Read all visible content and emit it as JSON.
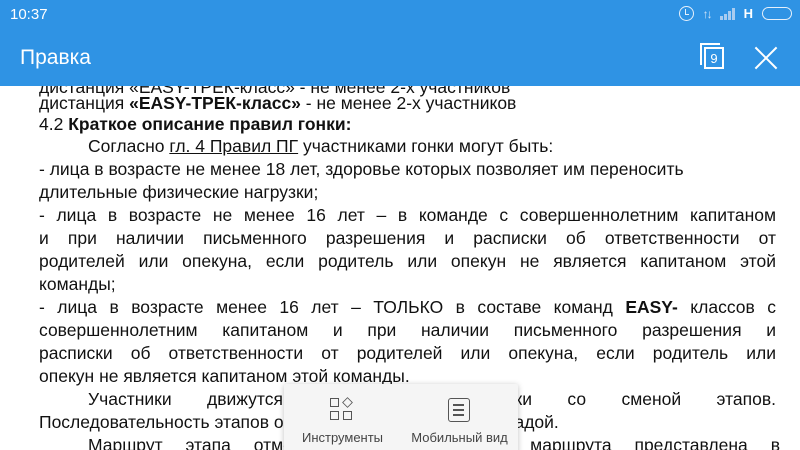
{
  "status_bar": {
    "time": "10:37",
    "network": "H"
  },
  "app_bar": {
    "title": "Правка",
    "pages_count": "9"
  },
  "document": {
    "lines": [
      {
        "segments": [
          {
            "text": "дистанция «EASY-ТРЕК-класс»  - не менее 2-х участников",
            "style": ""
          }
        ]
      },
      {
        "segments": [
          {
            "text": "дистанция ",
            "style": ""
          },
          {
            "text": "«EASY-ТРЕК-класс»",
            "style": "b"
          },
          {
            "text": "  - не менее 2-х участников",
            "style": ""
          }
        ]
      },
      {
        "segments": [
          {
            "text": "4.2 ",
            "style": ""
          },
          {
            "text": "Краткое описание правил гонки:",
            "style": "b"
          }
        ]
      },
      {
        "segments": [
          {
            "text": "Согласно ",
            "style": ""
          },
          {
            "text": "гл. 4 Правил ПГ",
            "style": "u"
          },
          {
            "text": " участниками гонки могут быть:",
            "style": ""
          }
        ]
      },
      {
        "segments": [
          {
            "text": "- лица в возрасте не менее 18 лет, здоровье которых позволяет им переносить",
            "style": ""
          }
        ]
      },
      {
        "segments": [
          {
            "text": "длительные физические нагрузки;",
            "style": ""
          }
        ]
      },
      {
        "segments": [
          {
            "text": "- лица в возрасте не менее 16 лет – в команде с совершеннолетним капитаном",
            "style": ""
          }
        ]
      },
      {
        "segments": [
          {
            "text": "и при наличии письменного разрешения и расписки об ответственности от",
            "style": ""
          }
        ]
      },
      {
        "segments": [
          {
            "text": "родителей или опекуна, если родитель или опекун не является капитаном этой",
            "style": ""
          }
        ]
      },
      {
        "segments": [
          {
            "text": "команды;",
            "style": ""
          }
        ]
      },
      {
        "segments": [
          {
            "text": "- лица в возрасте менее 16 лет – ТОЛЬКО в составе команд ",
            "style": ""
          },
          {
            "text": "EASY-",
            "style": "b"
          },
          {
            "text": " классов с",
            "style": ""
          }
        ]
      },
      {
        "segments": [
          {
            "text": "совершеннолетним капитаном и при наличии письменного разрешения и",
            "style": ""
          }
        ]
      },
      {
        "segments": [
          {
            "text": "расписки об ответственности от родителей или опекуна, если родитель или",
            "style": ""
          }
        ]
      },
      {
        "segments": [
          {
            "text": "опекун не является капитаном этой команды.",
            "style": ""
          }
        ]
      },
      {
        "segments": [
          {
            "text": "Участники движутся по маршруту гонки со сменой этапов.",
            "style": ""
          }
        ]
      },
      {
        "segments": [
          {
            "text": "Последовательность этапов определяется судейской бригадой.",
            "style": ""
          }
        ]
      },
      {
        "segments": [
          {
            "text": "Маршрут этапа отмечен на карте, схема маршрута представлена в",
            "style": ""
          }
        ]
      }
    ]
  },
  "toolbar": {
    "tools_label": "Инструменты",
    "mobile_label": "Мобильный вид"
  }
}
